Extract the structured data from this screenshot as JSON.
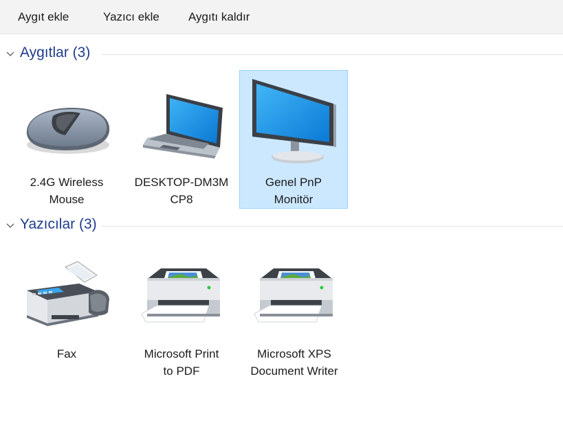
{
  "toolbar": {
    "add_device": "Aygıt ekle",
    "add_printer": "Yazıcı ekle",
    "remove_device": "Aygıtı kaldır"
  },
  "groups": {
    "devices": {
      "title": "Aygıtlar (3)",
      "items": [
        {
          "line1": "2.4G Wireless",
          "line2": "Mouse",
          "icon": "mouse-icon"
        },
        {
          "line1": "DESKTOP-DM3M",
          "line2": "CP8",
          "icon": "laptop-icon"
        },
        {
          "line1": "Genel PnP",
          "line2": "Monitör",
          "icon": "monitor-icon",
          "selected": true
        }
      ]
    },
    "printers": {
      "title": "Yazıcılar (3)",
      "items": [
        {
          "line1": "Fax",
          "line2": "",
          "icon": "fax-icon"
        },
        {
          "line1": "Microsoft Print",
          "line2": "to PDF",
          "icon": "printer-icon"
        },
        {
          "line1": "Microsoft XPS",
          "line2": "Document Writer",
          "icon": "printer-icon"
        }
      ]
    }
  },
  "colors": {
    "header_text": "#1e3c8c",
    "selection_bg": "#cce8ff",
    "selection_border": "#99d1ff",
    "toolbar_bg": "#f3f3f3"
  }
}
